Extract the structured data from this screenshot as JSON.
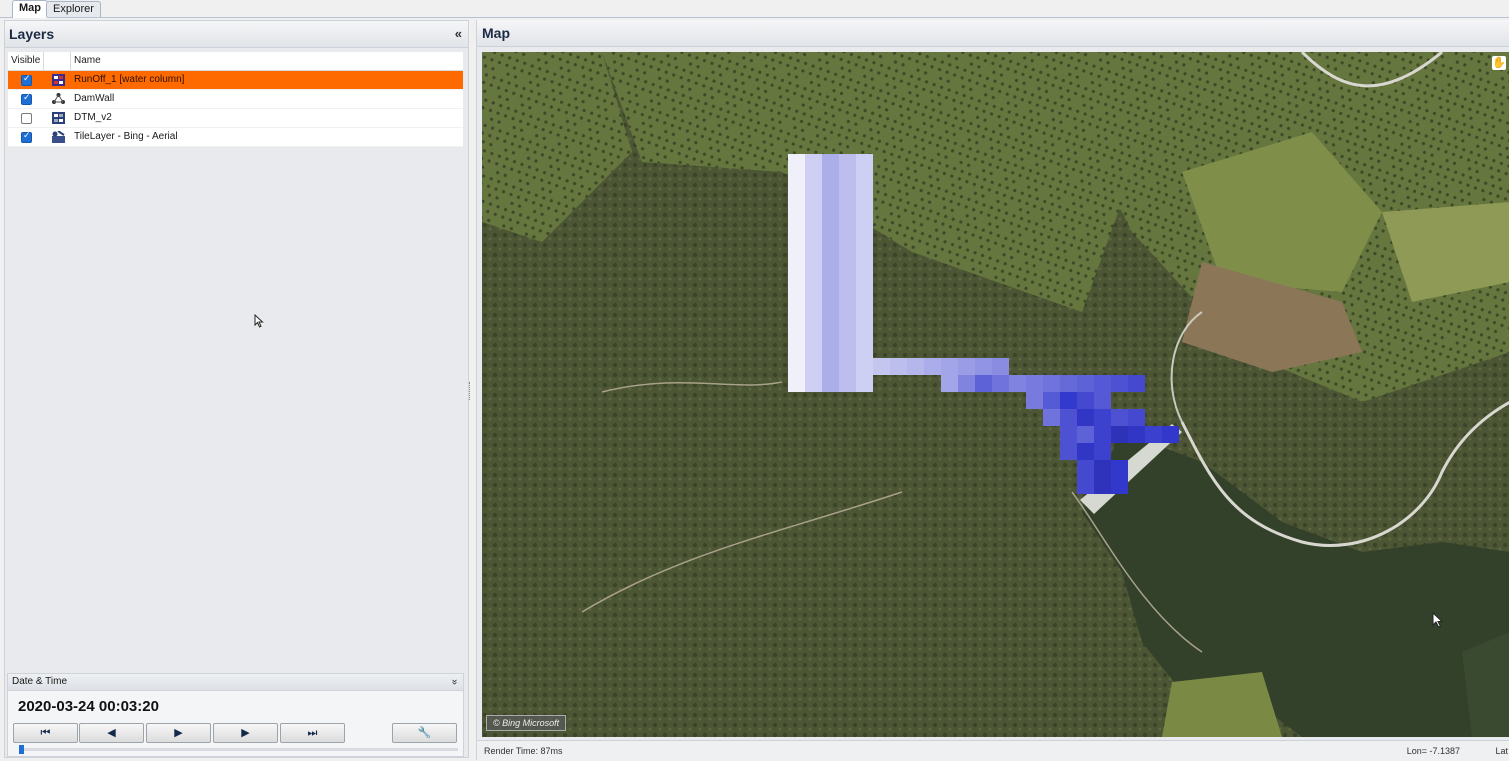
{
  "tabs": [
    {
      "label": "Map"
    },
    {
      "label": "Explorer"
    }
  ],
  "layers_panel": {
    "title": "Layers",
    "collapse_glyph": "«",
    "columns": {
      "visible": "Visible",
      "name": "Name"
    },
    "rows": [
      {
        "name": "RunOff_1 [water column]",
        "visible": true,
        "selected": true,
        "icon": "grid-layer-icon"
      },
      {
        "name": "DamWall",
        "visible": true,
        "selected": false,
        "icon": "network-layer-icon"
      },
      {
        "name": "DTM_v2",
        "visible": false,
        "selected": false,
        "icon": "grid-layer-icon"
      },
      {
        "name": "TileLayer - Bing - Aerial",
        "visible": true,
        "selected": false,
        "icon": "tile-layer-icon"
      }
    ]
  },
  "datetime_panel": {
    "title": "Date & Time",
    "collapse_glyph": "»",
    "value": "2020-03-24 00:03:20",
    "buttons": {
      "first": "⏮",
      "prev": "◀",
      "play": "▶",
      "next": "▶",
      "last": "⏭",
      "settings": "🔧"
    },
    "slider_fraction": 0.03
  },
  "map_panel": {
    "title": "Map",
    "attribution": "© Bing Microsoft",
    "status": {
      "render_time": "Render Time: 87ms",
      "lon": "Lon= -7.1387",
      "lat": "Lat"
    }
  },
  "colors": {
    "selection": "#ff6a00",
    "checkbox_on": "#1d6fd6",
    "water_column": "#5a5fd0"
  }
}
